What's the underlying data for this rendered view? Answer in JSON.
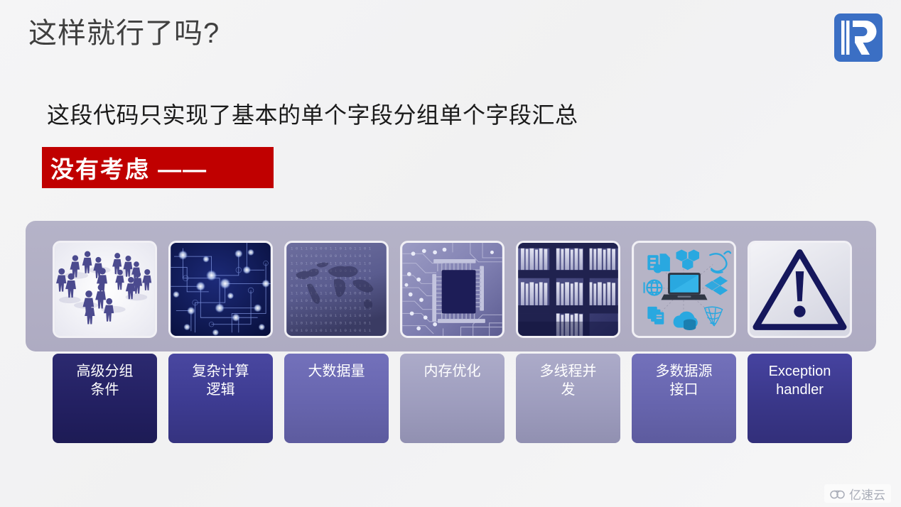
{
  "slide": {
    "title": "这样就行了吗?",
    "subtitle": "这段代码只实现了基本的单个字段分组单个字段汇总",
    "banner_text": "没有考虑 ——",
    "banner_color": "#c00000",
    "background_color": "#f2f2f3",
    "panel_color": "#b1aec5"
  },
  "logo": {
    "name": "brand-logo-r",
    "color": "#3b6fc4"
  },
  "items": [
    {
      "label": "高级分组\n条件",
      "box_color": "#232062",
      "image_name": "crowd-of-people-figures",
      "image_alt": "蓝紫色人群立体小人"
    },
    {
      "label": "复杂计算\n逻辑",
      "box_color": "#3d3b91",
      "image_name": "network-circuit-nodes",
      "image_alt": "深蓝色电路网络节点"
    },
    {
      "label": "大数据量",
      "box_color": "#6765ae",
      "image_name": "binary-world-map",
      "image_alt": "二进制数字雨世界地图"
    },
    {
      "label": "内存优化",
      "box_color": "#9e9dbe",
      "image_name": "cpu-chip-circuit-board",
      "image_alt": "CPU芯片电路板"
    },
    {
      "label": "多线程并\n发",
      "box_color": "#9e9dbe",
      "image_name": "archive-shelves-binders",
      "image_alt": "档案架文件夹"
    },
    {
      "label": "多数据源\n接口",
      "box_color": "#6765ae",
      "image_name": "data-sources-icons",
      "image_alt": "多数据源图标笔记本电脑"
    },
    {
      "label": "Exception\nhandler",
      "box_color": "#3a3789",
      "image_name": "warning-triangle-exclamation",
      "image_alt": "警告三角感叹号"
    }
  ],
  "watermark": {
    "text": "亿速云",
    "icon": "cloud-icon",
    "color": "#a9adb8"
  }
}
